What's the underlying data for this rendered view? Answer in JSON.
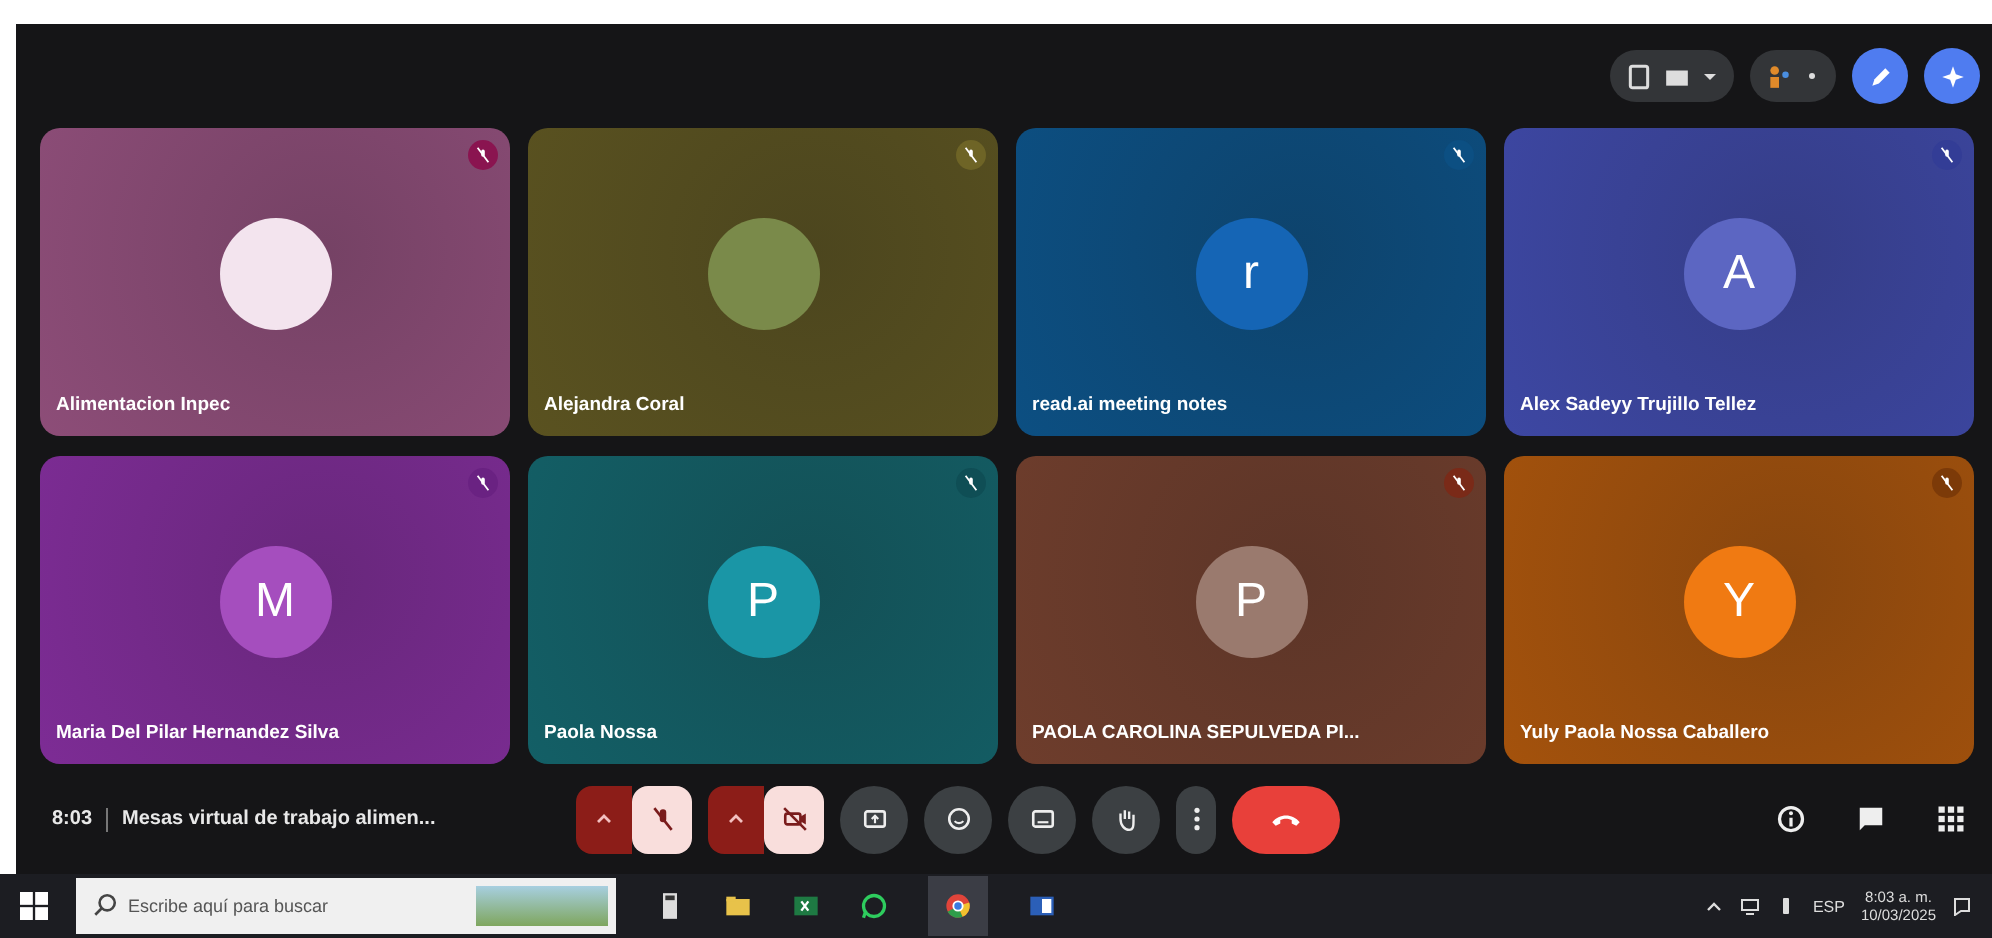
{
  "tiles": [
    {
      "name": "Alimentacion Inpec",
      "color": "#8d4d78",
      "avatar": {
        "kind": "logo",
        "color": "#f3e4ee"
      },
      "muted_badge": {
        "color": "#8a1450"
      }
    },
    {
      "name": "Alejandra Coral",
      "color": "#5a5220",
      "avatar": {
        "kind": "photo",
        "color": "#7a8a4a"
      },
      "muted_badge": {
        "color": "#6e6426"
      }
    },
    {
      "name": "read.ai meeting notes",
      "color": "#0c4f82",
      "avatar": {
        "kind": "letter",
        "initial": "r",
        "color": "#1565b5"
      },
      "muted_badge": {
        "color": "#0c4f82"
      }
    },
    {
      "name": "Alex Sadeyy Trujillo Tellez",
      "color": "#3d47a3",
      "avatar": {
        "kind": "letter",
        "initial": "A",
        "color": "#5c66c2"
      },
      "muted_badge": {
        "color": "#333d96"
      }
    },
    {
      "name": "Maria Del Pilar Hernandez Silva",
      "color": "#7d2c95",
      "avatar": {
        "kind": "letter",
        "initial": "M",
        "color": "#a54ebe"
      },
      "muted_badge": {
        "color": "#6a2282"
      }
    },
    {
      "name": "Paola Nossa",
      "color": "#135f66",
      "avatar": {
        "kind": "letter",
        "initial": "P",
        "color": "#1a96a6"
      },
      "muted_badge": {
        "color": "#0f4e55"
      }
    },
    {
      "name": "PAOLA CAROLINA SEPULVEDA PI...",
      "color": "#6e3d2c",
      "avatar": {
        "kind": "letter",
        "initial": "P",
        "color": "#9a7a6e"
      },
      "muted_badge": {
        "color": "#7a2a18"
      }
    },
    {
      "name": "Yuly Paola Nossa Caballero",
      "color": "#a4520c",
      "avatar": {
        "kind": "letter",
        "initial": "Y",
        "color": "#f07a12"
      },
      "muted_badge": {
        "color": "#7c3a08"
      }
    }
  ],
  "meeting": {
    "time": "8:03",
    "title": "Mesas virtual de trabajo alimen..."
  },
  "controls": [
    {
      "kind": "mic",
      "on": false
    },
    {
      "kind": "camera",
      "on": false
    },
    {
      "kind": "present"
    },
    {
      "kind": "emoji"
    },
    {
      "kind": "captions"
    },
    {
      "kind": "hand"
    },
    {
      "kind": "more"
    },
    {
      "kind": "leave"
    }
  ],
  "side_controls": [
    {
      "kind": "info"
    },
    {
      "kind": "chat"
    },
    {
      "kind": "activities"
    }
  ],
  "taskbar": {
    "search_placeholder": "Escribe aquí para buscar",
    "language": "ESP",
    "time": "8:03 a. m.",
    "date": "10/03/2025"
  }
}
